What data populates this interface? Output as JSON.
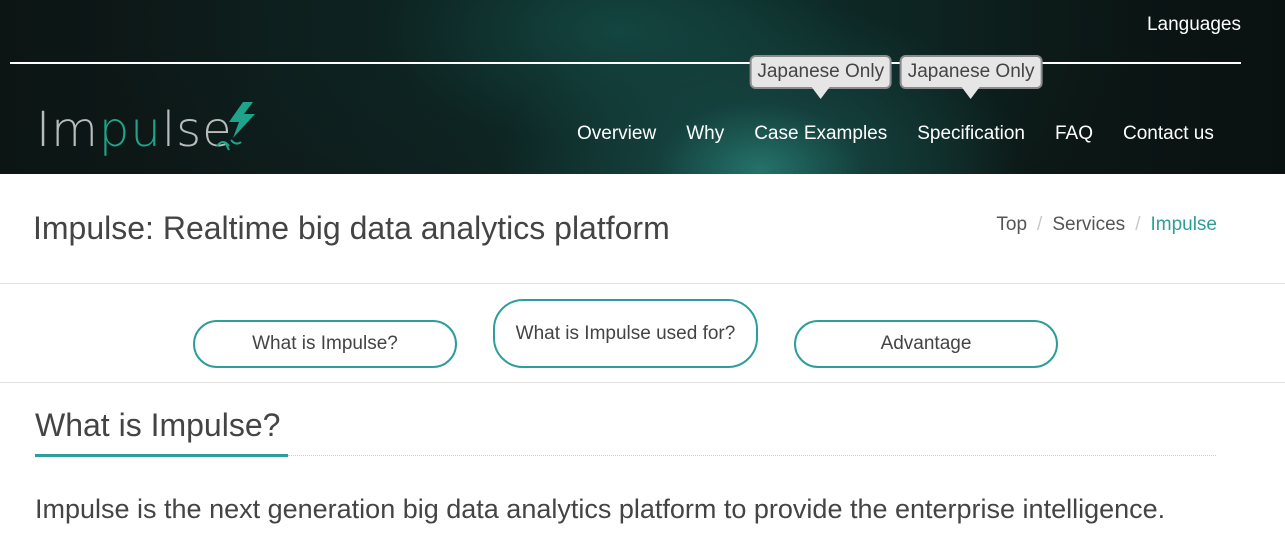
{
  "header": {
    "languages_label": "Languages",
    "logo": {
      "text_before": "Im",
      "text_accent": "pu",
      "text_after": "lse"
    },
    "nav": [
      {
        "label": "Overview",
        "tooltip": ""
      },
      {
        "label": "Why",
        "tooltip": ""
      },
      {
        "label": "Case Examples",
        "tooltip": "Japanese Only"
      },
      {
        "label": "Specification",
        "tooltip": "Japanese Only"
      },
      {
        "label": "FAQ",
        "tooltip": ""
      },
      {
        "label": "Contact us",
        "tooltip": ""
      }
    ]
  },
  "title_band": {
    "title": "Impulse: Realtime big data analytics platform",
    "breadcrumb": [
      "Top",
      "Services",
      "Impulse"
    ]
  },
  "section_buttons": [
    {
      "label": "What is Impulse?"
    },
    {
      "label": "What is Impulse used for?"
    },
    {
      "label": "Advantage"
    }
  ],
  "content": {
    "heading": "What is Impulse?",
    "intro": "Impulse is the next generation big data analytics platform to provide the enterprise intelligence."
  },
  "colors": {
    "accent": "#2e9e9a",
    "logo_accent": "#1fa38b",
    "header_dark": "#0c1514",
    "text": "#444444"
  },
  "icons": {
    "logo_mark": "lightning-bolt-icon"
  }
}
